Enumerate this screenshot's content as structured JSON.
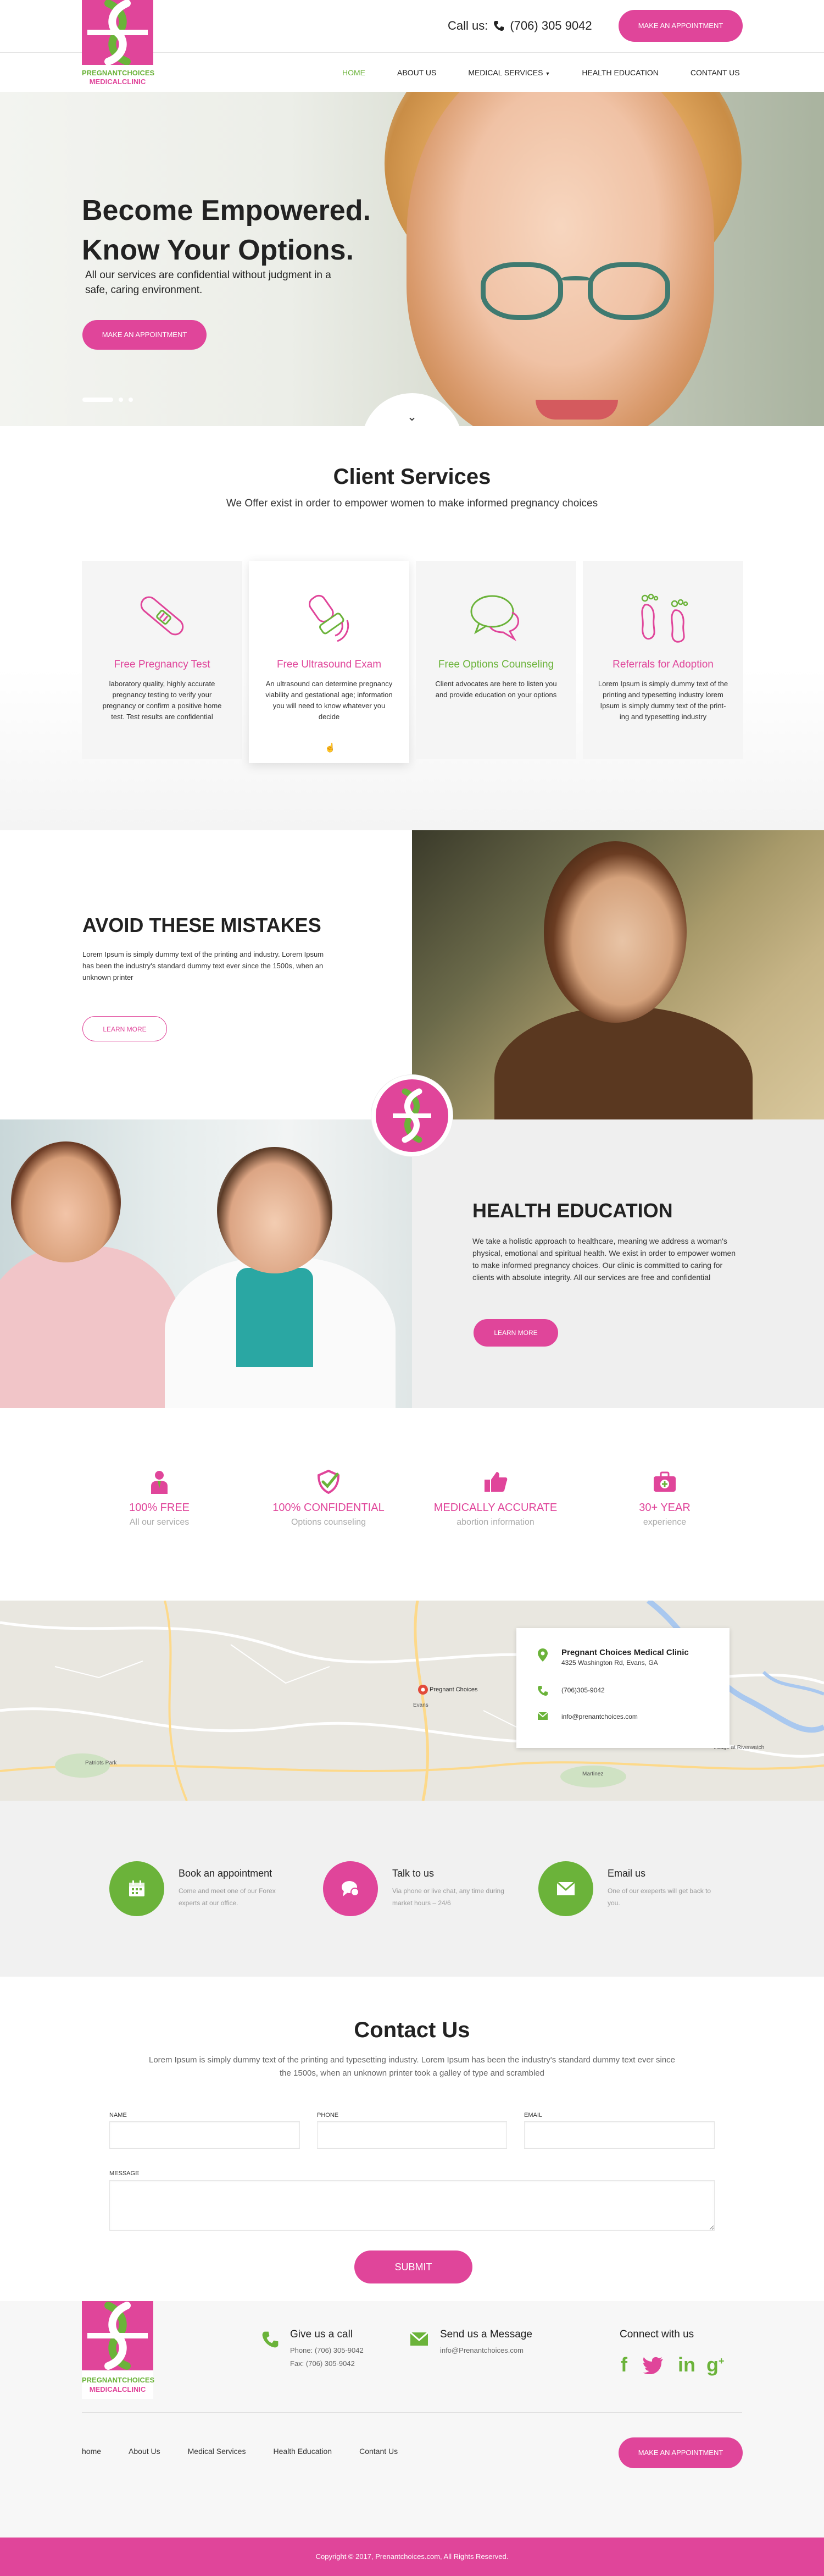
{
  "brand": {
    "logo_line1": "PREGNANTCHOICES",
    "logo_line2": "MEDICALCLINIC",
    "pink": "#e0459a",
    "green": "#6bb33a"
  },
  "header": {
    "call_label": "Call us:",
    "phone": "(706) 305 9042",
    "appointment_button": "MAKE AN APPOINTMENT"
  },
  "nav": {
    "items": [
      {
        "label": "HOME"
      },
      {
        "label": "ABOUT US"
      },
      {
        "label": "MEDICAL SERVICES"
      },
      {
        "label": "HEALTH EDUCATION"
      },
      {
        "label": "CONTANT US"
      }
    ],
    "active_index": 0
  },
  "hero": {
    "title_line1": "Become Empowered.",
    "title_line2": "Know Your Options.",
    "subtitle": "All our services are confidential without judgment in a safe, caring environment.",
    "button": "MAKE AN APPOINTMENT",
    "slide_count": 3,
    "active_slide": 1
  },
  "services": {
    "title": "Client Services",
    "subtitle": "We Offer exist in order to empower women to make informed pregnancy choices",
    "cards": [
      {
        "title": "Free Pregnancy Test",
        "text": "laboratory quality, highly accurate pregnancy testing to verify your pregnancy or confirm a positive home test. Test results are confidential",
        "icon": "pregnancy-test-icon"
      },
      {
        "title": "Free Ultrasound Exam",
        "text": "An ultrasound can determine pregnancy viability and gestational age; information you will need to know whatever you decide",
        "icon": "ultrasound-icon"
      },
      {
        "title": "Free Options Counseling",
        "text": "Client advocates are here to listen you and provide education on your options",
        "icon": "chat-bubbles-icon"
      },
      {
        "title": "Referrals for Adoption",
        "text": "Lorem Ipsum is simply dummy text of the printing and typesetting industry lorem Ipsum is simply dummy text of the print-ing and typesetting industry",
        "icon": "footprints-icon"
      }
    ]
  },
  "avoid": {
    "title": "AVOID THESE MISTAKES",
    "text": "Lorem Ipsum is simply dummy text of the printing and industry. Lorem Ipsum has been the industry's standard dummy text ever since the 1500s, when an unknown printer",
    "button": "LEARN MORE"
  },
  "health": {
    "title": "HEALTH EDUCATION",
    "text": "We take a holistic approach to healthcare, meaning we address a woman's physical, emotional and spiritual health. We exist in order to empower women to make informed pregnancy choices. Our clinic is committed to caring for clients with absolute integrity. All our services are free and confidential",
    "button": "LEARN MORE"
  },
  "features": [
    {
      "title": "100% FREE",
      "sub": "All our services",
      "icon": "doctor-icon"
    },
    {
      "title": "100% CONFIDENTIAL",
      "sub": "Options counseling",
      "icon": "shield-check-icon"
    },
    {
      "title": "MEDICALLY ACCURATE",
      "sub": "abortion information",
      "icon": "thumbs-up-icon"
    },
    {
      "title": "30+ YEAR",
      "sub": "experience",
      "icon": "medical-bag-icon"
    }
  ],
  "map": {
    "pin_label": "Pregnant Choices",
    "labels": [
      "Evans",
      "Martinez",
      "Patriots Park",
      "Village at Riverwatch"
    ],
    "clinic_name": "Pregnant Choices Medical Clinic",
    "address": "4325 Washington Rd, Evans, GA",
    "phone": "(706)305-9042",
    "email": "info@prenantchoices.com"
  },
  "contact_options": [
    {
      "title": "Book an appointment",
      "text": "Come and meet one of our Forex experts at our office.",
      "icon": "calendar-icon"
    },
    {
      "title": "Talk to us",
      "text": "Via phone or live chat, any time during market hours – 24/6",
      "icon": "chat-icon"
    },
    {
      "title": "Email us",
      "text": "One of our exeperts will get back to you.",
      "icon": "envelope-icon"
    }
  ],
  "contact": {
    "title": "Contact Us",
    "subtitle": "Lorem Ipsum is simply dummy text of the printing and typesetting industry. Lorem Ipsum has been the industry's standard dummy text ever since the 1500s, when an unknown printer took a galley of type and scrambled",
    "name_label": "NAME",
    "phone_label": "PHONE",
    "email_label": "EMAIL",
    "message_label": "MESSAGE",
    "submit": "SUBMIT"
  },
  "footer": {
    "call_title": "Give us a call",
    "call_phone": "Phone: (706) 305-9042",
    "call_fax": "Fax: (706) 305-9042",
    "msg_title": "Send us a Message",
    "msg_email": "info@Prenantchoices.com",
    "connect_title": "Connect with us",
    "links": [
      "home",
      "About Us",
      "Medical Services",
      "Health Education",
      "Contant Us"
    ],
    "button": "MAKE AN APPOINTMENT",
    "copyright": "Copyright © 2017, Prenantchoices.com, All Rights Reserved."
  }
}
